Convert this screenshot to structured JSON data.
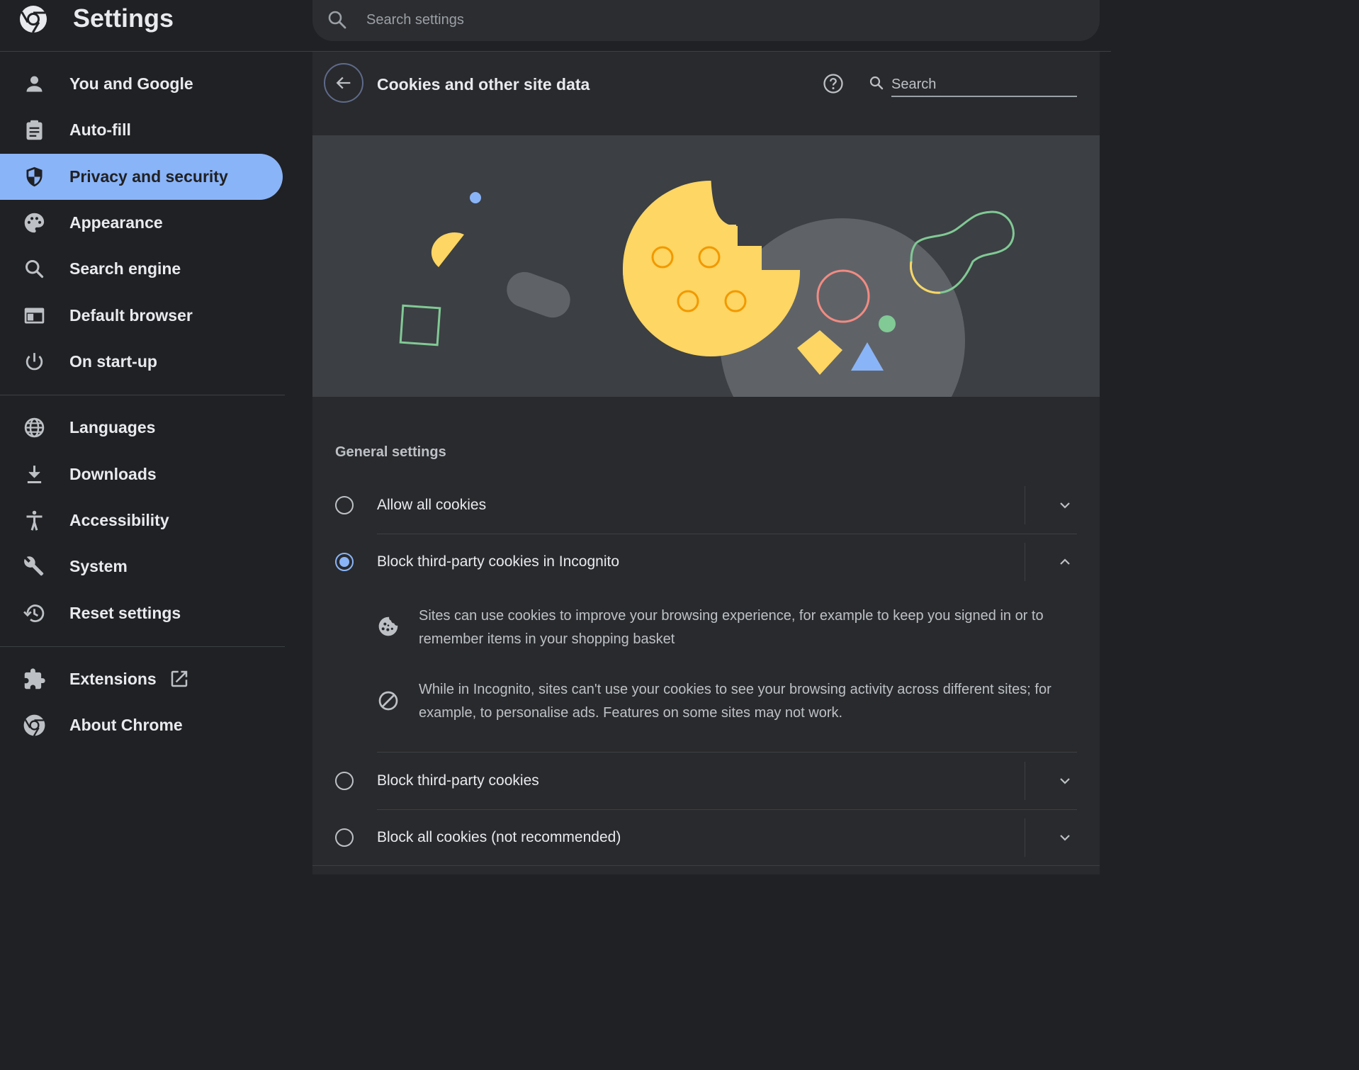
{
  "app": {
    "title": "Settings",
    "logo_icon": "chrome-logo-icon",
    "search_placeholder": "Search settings"
  },
  "sidebar": {
    "items": [
      {
        "label": "You and Google",
        "icon": "person-icon",
        "active": false
      },
      {
        "label": "Auto-fill",
        "icon": "clipboard-icon",
        "active": false
      },
      {
        "label": "Privacy and security",
        "icon": "shield-icon",
        "active": true
      },
      {
        "label": "Appearance",
        "icon": "palette-icon",
        "active": false
      },
      {
        "label": "Search engine",
        "icon": "search-icon",
        "active": false
      },
      {
        "label": "Default browser",
        "icon": "browser-icon",
        "active": false
      },
      {
        "label": "On start-up",
        "icon": "power-icon",
        "active": false
      },
      {
        "label": "Languages",
        "icon": "globe-icon",
        "active": false
      },
      {
        "label": "Downloads",
        "icon": "download-icon",
        "active": false
      },
      {
        "label": "Accessibility",
        "icon": "accessibility-icon",
        "active": false
      },
      {
        "label": "System",
        "icon": "wrench-icon",
        "active": false
      },
      {
        "label": "Reset settings",
        "icon": "history-icon",
        "active": false
      },
      {
        "label": "Extensions",
        "icon": "puzzle-icon",
        "active": false,
        "external_icon": "open-in-new-icon"
      },
      {
        "label": "About Chrome",
        "icon": "chrome-icon",
        "active": false
      }
    ]
  },
  "main": {
    "title": "Cookies and other site data",
    "help_icon": "help-icon",
    "search_placeholder": "Search",
    "section_title": "General settings",
    "options": [
      {
        "label": "Allow all cookies",
        "checked": false,
        "expanded": false
      },
      {
        "label": "Block third-party cookies in Incognito",
        "checked": true,
        "expanded": true
      },
      {
        "label": "Block third-party cookies",
        "checked": false,
        "expanded": false
      },
      {
        "label": "Block all cookies (not recommended)",
        "checked": false,
        "expanded": false
      }
    ],
    "details": [
      {
        "icon": "cookie-icon",
        "text": "Sites can use cookies to improve your browsing experience, for example to keep you signed in or to remember items in your shopping basket"
      },
      {
        "icon": "block-icon",
        "text": "While in Incognito, sites can't use your cookies to see your browsing activity across different sites; for example, to personalise ads. Features on some sites may not work."
      }
    ]
  },
  "colors": {
    "accent": "#8ab4f8",
    "background": "#202124",
    "panel": "#292a2d",
    "cookie_yellow": "#fdd663"
  }
}
